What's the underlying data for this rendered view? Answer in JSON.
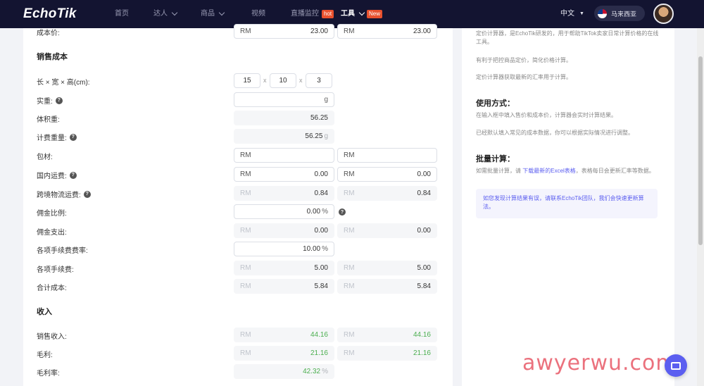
{
  "nav": {
    "logo": "EchoTik",
    "items": [
      {
        "label": "首页"
      },
      {
        "label": "达人"
      },
      {
        "label": "商品"
      },
      {
        "label": "视频"
      },
      {
        "label": "直播监控",
        "badge": "hot"
      },
      {
        "label": "工具",
        "badge": "New"
      }
    ],
    "language": "中文",
    "region": "马来西亚"
  },
  "calculator": {
    "cost_price": {
      "label": "成本价:",
      "currency": "RM",
      "value1": "23.00",
      "value2": "23.00"
    },
    "section_sales_cost": "销售成本",
    "dimensions": {
      "label": "长 × 宽 × 高(cm):",
      "length": "15",
      "width": "10",
      "height": "3",
      "sep": "x"
    },
    "actual_weight": {
      "label": "实重:",
      "value": "",
      "unit": "g"
    },
    "volume_weight": {
      "label": "体积重:",
      "value": "56.25"
    },
    "billing_weight": {
      "label": "计费重量:",
      "value": "56.25",
      "unit": "g"
    },
    "packaging": {
      "label": "包材:",
      "currency": "RM",
      "value1": "",
      "value2": ""
    },
    "domestic_shipping": {
      "label": "国内运费:",
      "currency": "RM",
      "value1": "0.00",
      "value2": "0.00"
    },
    "cross_border_shipping": {
      "label": "跨境物流运费:",
      "currency": "RM",
      "value1": "0.84",
      "value2": "0.84"
    },
    "commission_rate": {
      "label": "佣金比例:",
      "value": "0.00",
      "unit": "%"
    },
    "commission_expense": {
      "label": "佣金支出:",
      "currency": "RM",
      "value1": "0.00",
      "value2": "0.00"
    },
    "fee_rate": {
      "label": "各项手续费费率:",
      "value": "10.00",
      "unit": "%"
    },
    "fees": {
      "label": "各项手续费:",
      "currency": "RM",
      "value1": "5.00",
      "value2": "5.00"
    },
    "total_cost": {
      "label": "合计成本:",
      "currency": "RM",
      "value1": "5.84",
      "value2": "5.84"
    },
    "section_income": "收入",
    "sales_income": {
      "label": "销售收入:",
      "currency": "RM",
      "value1": "44.16",
      "value2": "44.16"
    },
    "gross_profit": {
      "label": "毛利:",
      "currency": "RM",
      "value1": "21.16",
      "value2": "21.16"
    },
    "gross_margin": {
      "label": "毛利率:",
      "value": "42.32",
      "unit": "%"
    }
  },
  "side": {
    "intro1": "定价计算器，是EchoTik研发的，用于帮助TikTok卖家日常计算价格的在线工具。",
    "intro2": "有利于把控商品定价，简化价格计算。",
    "intro3": "定价计算器获取最新的汇率用于计算。",
    "usage_title": "使用方式：",
    "usage1": "在输入框中填入售价和成本价，计算器会实时计算结果。",
    "usage2": "已经默认填入常见的成本数据，你可以根据实际情况进行调整。",
    "batch_title": "批量计算：",
    "batch_prefix": "如需批量计算，请 ",
    "batch_link": "下载最新的Excel表格",
    "batch_suffix": "，表格每日会更新汇率等数据。",
    "notice": "如您发现计算结果有误，请联系EchoTik团队，我们会快速更新算法。"
  },
  "watermark": "awyerwu.com",
  "colors": {
    "nav_bg": "#131431",
    "accent": "#5b5ef0",
    "hot": "#e8512e",
    "green": "#4caf50"
  }
}
